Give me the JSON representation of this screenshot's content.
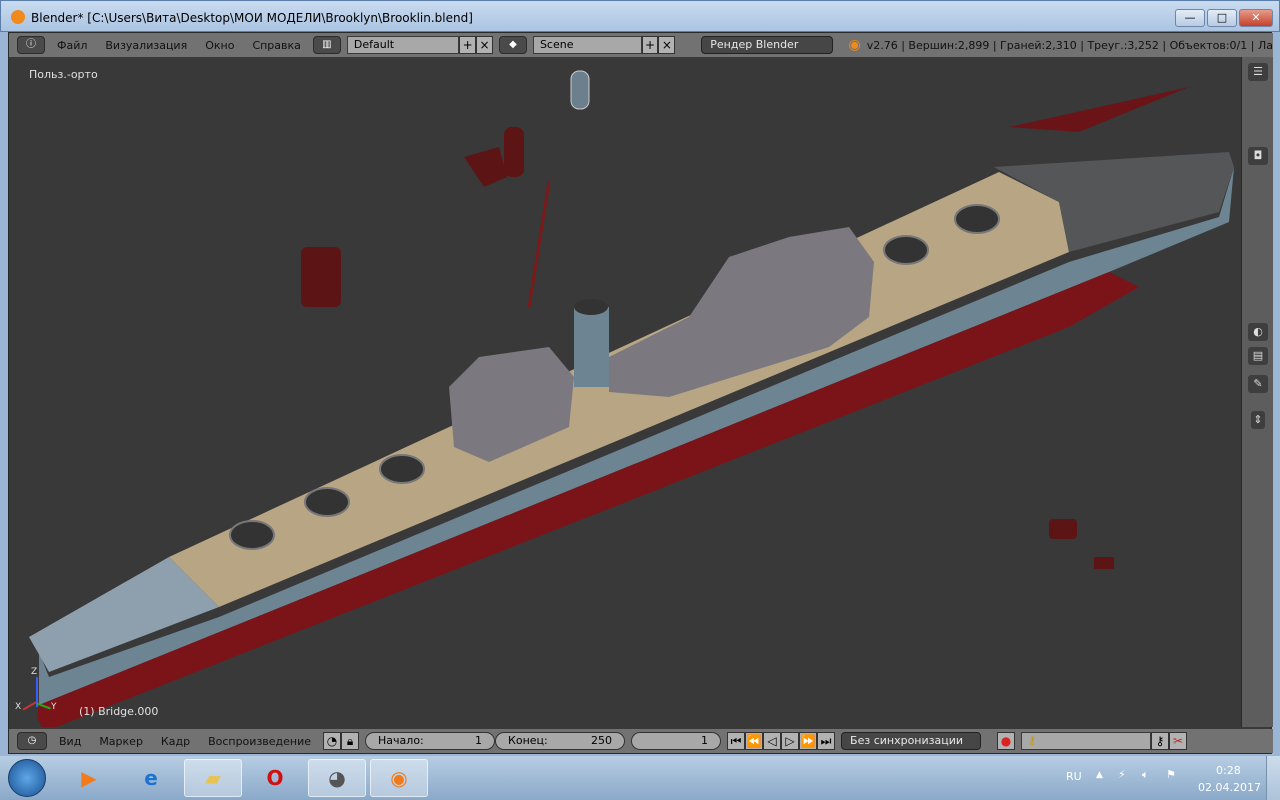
{
  "window": {
    "title": "Blender* [C:\\Users\\Вита\\Desktop\\МОИ МОДЕЛИ\\Brooklyn\\Brooklin.blend]",
    "minimize": "—",
    "maximize": "□",
    "close": "✕"
  },
  "top_header": {
    "menus": [
      "Файл",
      "Визуализация",
      "Окно",
      "Справка"
    ],
    "layout": "Default",
    "scene": "Scene",
    "render_engine": "Рендер Blender",
    "stats": "v2.76 | Вершин:2,899 | Граней:2,310 | Треуг.:3,252 | Объектов:0/1 | Ла"
  },
  "viewport": {
    "view_label": "Польз.-орто",
    "object_label": "(1) Bridge.000",
    "axis_x": "X",
    "axis_y": "Y",
    "axis_z": "Z"
  },
  "timeline": {
    "menus": [
      "Вид",
      "Маркер",
      "Кадр",
      "Воспроизведение"
    ],
    "start_label": "Начало:",
    "start": "1",
    "end_label": "Конец:",
    "end": "250",
    "current": "1",
    "sync": "Без синхронизации"
  },
  "taskbar": {
    "lang": "RU",
    "time": "0:28",
    "date": "02.04.2017"
  },
  "colors": {
    "viewport_bg": "#393939",
    "header_bg": "#727272",
    "deck": "#b8a584",
    "hull": "#6d8593",
    "hull_red": "#7a1418"
  }
}
